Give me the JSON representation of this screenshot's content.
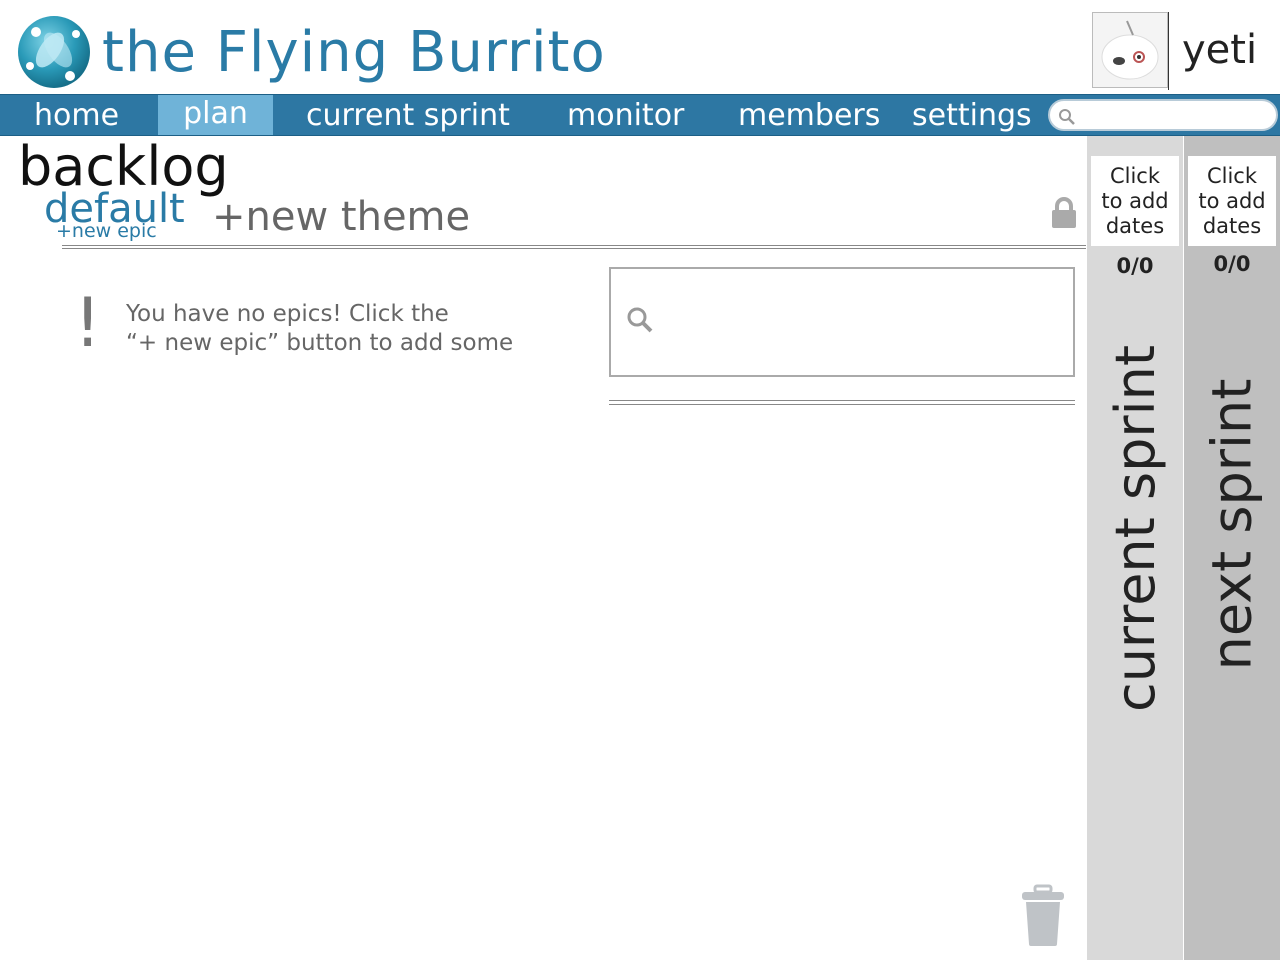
{
  "header": {
    "title": "the Flying Burrito",
    "username": "yeti",
    "logo_icon": "globe-logo-icon",
    "avatar_icon": "yeti-avatar-icon",
    "accent_color": "#2a7ba6"
  },
  "nav": {
    "items": [
      {
        "label": "home"
      },
      {
        "label": "plan",
        "active": true
      },
      {
        "label": "current sprint"
      },
      {
        "label": "monitor"
      },
      {
        "label": "members"
      },
      {
        "label": "settings"
      }
    ],
    "search_placeholder": "",
    "bar_color": "#2d77a3",
    "active_color": "#6fb3d8"
  },
  "main": {
    "title": "backlog",
    "theme": "default",
    "new_epic": "+new epic",
    "new_theme": "+new theme",
    "empty_mark": "!",
    "empty_line1": "You have no epics! Click the",
    "empty_line2": "“+ new epic”  button to add some",
    "search_placeholder": ""
  },
  "sprints": [
    {
      "name": "current sprint",
      "dates_line1": "Click",
      "dates_line2": "to add",
      "dates_line3": "dates",
      "count": "0/0"
    },
    {
      "name": "next sprint",
      "dates_line1": "Click",
      "dates_line2": "to add",
      "dates_line3": "dates",
      "count": "0/0"
    }
  ]
}
